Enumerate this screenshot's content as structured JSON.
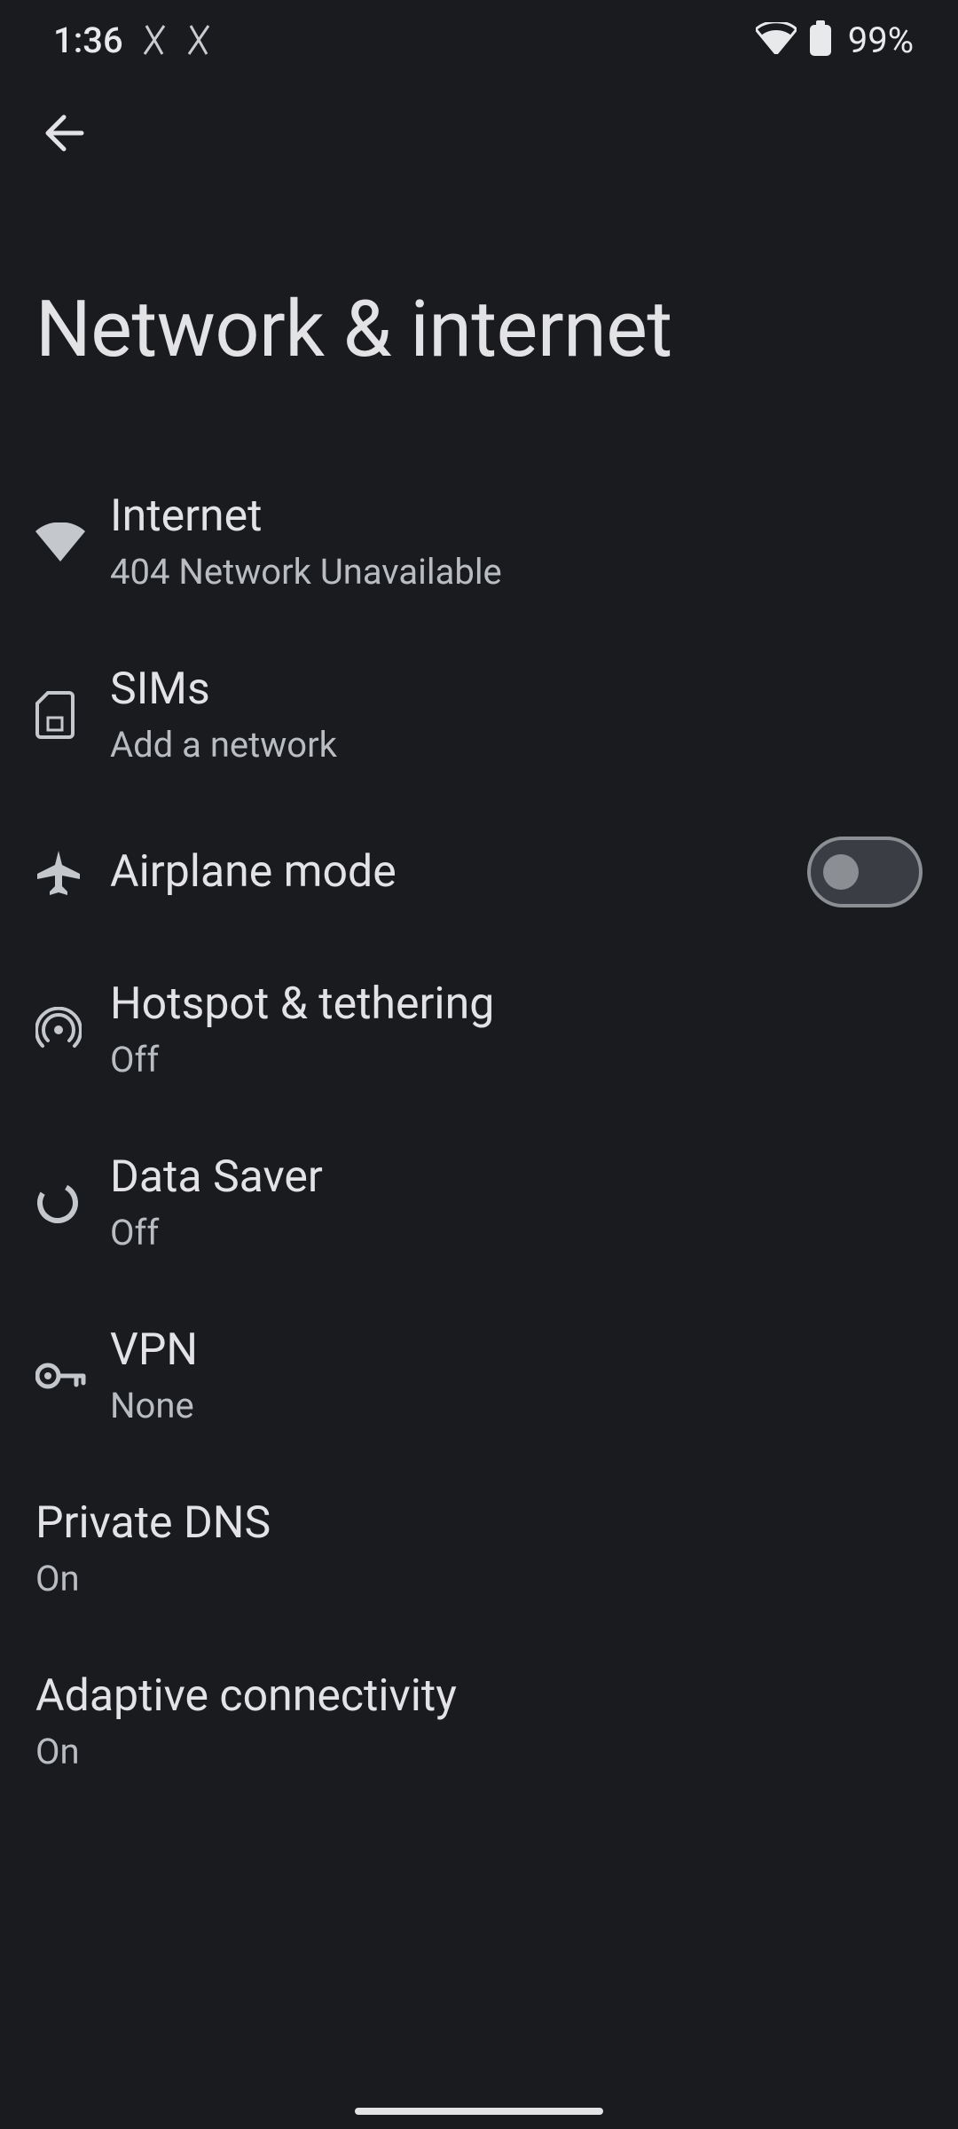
{
  "status": {
    "time": "1:36",
    "battery": "99%"
  },
  "page": {
    "title": "Network & internet"
  },
  "items": {
    "internet": {
      "title": "Internet",
      "sub": "404 Network Unavailable"
    },
    "sims": {
      "title": "SIMs",
      "sub": "Add a network"
    },
    "airplane": {
      "title": "Airplane mode",
      "on": false
    },
    "hotspot": {
      "title": "Hotspot & tethering",
      "sub": "Off"
    },
    "datasaver": {
      "title": "Data Saver",
      "sub": "Off"
    },
    "vpn": {
      "title": "VPN",
      "sub": "None"
    },
    "privatedns": {
      "title": "Private DNS",
      "sub": "On"
    },
    "adaptive": {
      "title": "Adaptive connectivity",
      "sub": "On"
    }
  }
}
